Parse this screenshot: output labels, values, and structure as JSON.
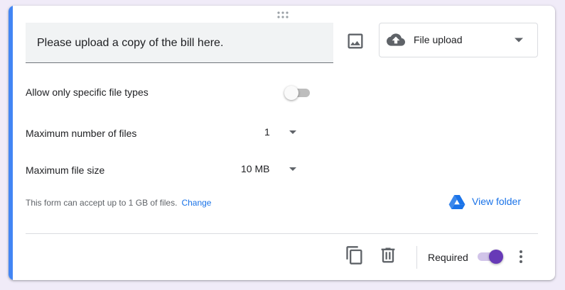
{
  "question": {
    "text": "Please upload a copy of the bill here."
  },
  "question_type": {
    "label": "File upload",
    "icon": "cloud-upload-icon"
  },
  "settings": {
    "allow_specific_types": {
      "label": "Allow only specific file types",
      "enabled": false
    },
    "max_files": {
      "label": "Maximum number of files",
      "value": "1"
    },
    "max_size": {
      "label": "Maximum file size",
      "value": "10 MB"
    }
  },
  "footnote": {
    "text": "This form can accept up to 1 GB of files.",
    "link_label": "Change"
  },
  "view_folder": {
    "label": "View folder",
    "icon": "google-drive-icon"
  },
  "footer": {
    "required_label": "Required",
    "required_enabled": true
  },
  "colors": {
    "accent": "#4285f4",
    "link": "#1a73e8",
    "toggle_on": "#673ab7",
    "background": "#f0ebf8"
  }
}
